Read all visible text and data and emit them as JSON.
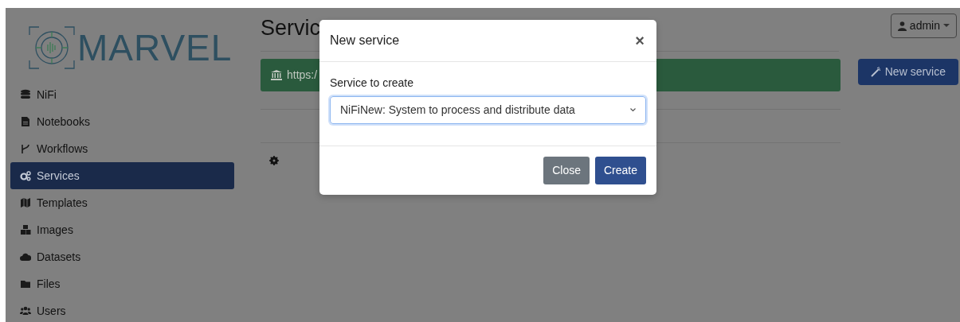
{
  "logo": {
    "text": "MARVEL"
  },
  "sidebar": {
    "items": [
      {
        "label": "NiFi",
        "kind": "database",
        "selected": false
      },
      {
        "label": "Notebooks",
        "kind": "file",
        "selected": false
      },
      {
        "label": "Workflows",
        "kind": "branch",
        "selected": false
      },
      {
        "label": "Services",
        "kind": "gears",
        "selected": true
      },
      {
        "label": "Templates",
        "kind": "map",
        "selected": false
      },
      {
        "label": "Images",
        "kind": "cubes",
        "selected": false
      },
      {
        "label": "Datasets",
        "kind": "cloud",
        "selected": false
      },
      {
        "label": "Files",
        "kind": "folder",
        "selected": false
      },
      {
        "label": "Users",
        "kind": "users",
        "selected": false
      }
    ]
  },
  "header": {
    "title": "Servic",
    "user_menu": "admin"
  },
  "banner": {
    "text": "https:/"
  },
  "new_service_button": "New service",
  "modal": {
    "title": "New service",
    "close": "×",
    "field_label": "Service to create",
    "select_value": "NiFiNew: System to process and distribute data",
    "buttons": [
      {
        "label": "Close",
        "kind": "secondary"
      },
      {
        "label": "Create",
        "kind": "primary"
      }
    ]
  }
}
